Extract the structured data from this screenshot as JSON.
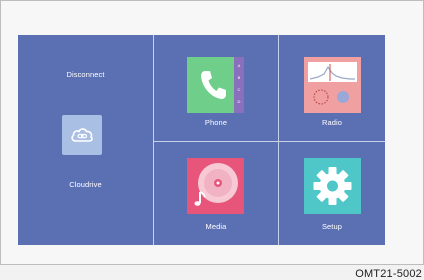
{
  "left_panel": {
    "disconnect_label": "Disconnect",
    "cloudrive_label": "Cloudrive",
    "cloud_icon": "cloud-link-icon"
  },
  "tiles": {
    "phone": {
      "label": "Phone",
      "icon": "phone-icon",
      "strip_letters": [
        "A",
        "B",
        "C",
        "D"
      ]
    },
    "radio": {
      "label": "Radio",
      "icon": "radio-icon"
    },
    "media": {
      "label": "Media",
      "icon": "music-disc-icon"
    },
    "setup": {
      "label": "Setup",
      "icon": "gear-icon"
    }
  },
  "caption": "OMT21-5002",
  "colors": {
    "screen_bg": "#5b6fb3",
    "phone_green": "#6fcf8a",
    "radio_red": "#f0a0a0",
    "media_pink": "#e8557a",
    "setup_teal": "#4fc7c9"
  }
}
